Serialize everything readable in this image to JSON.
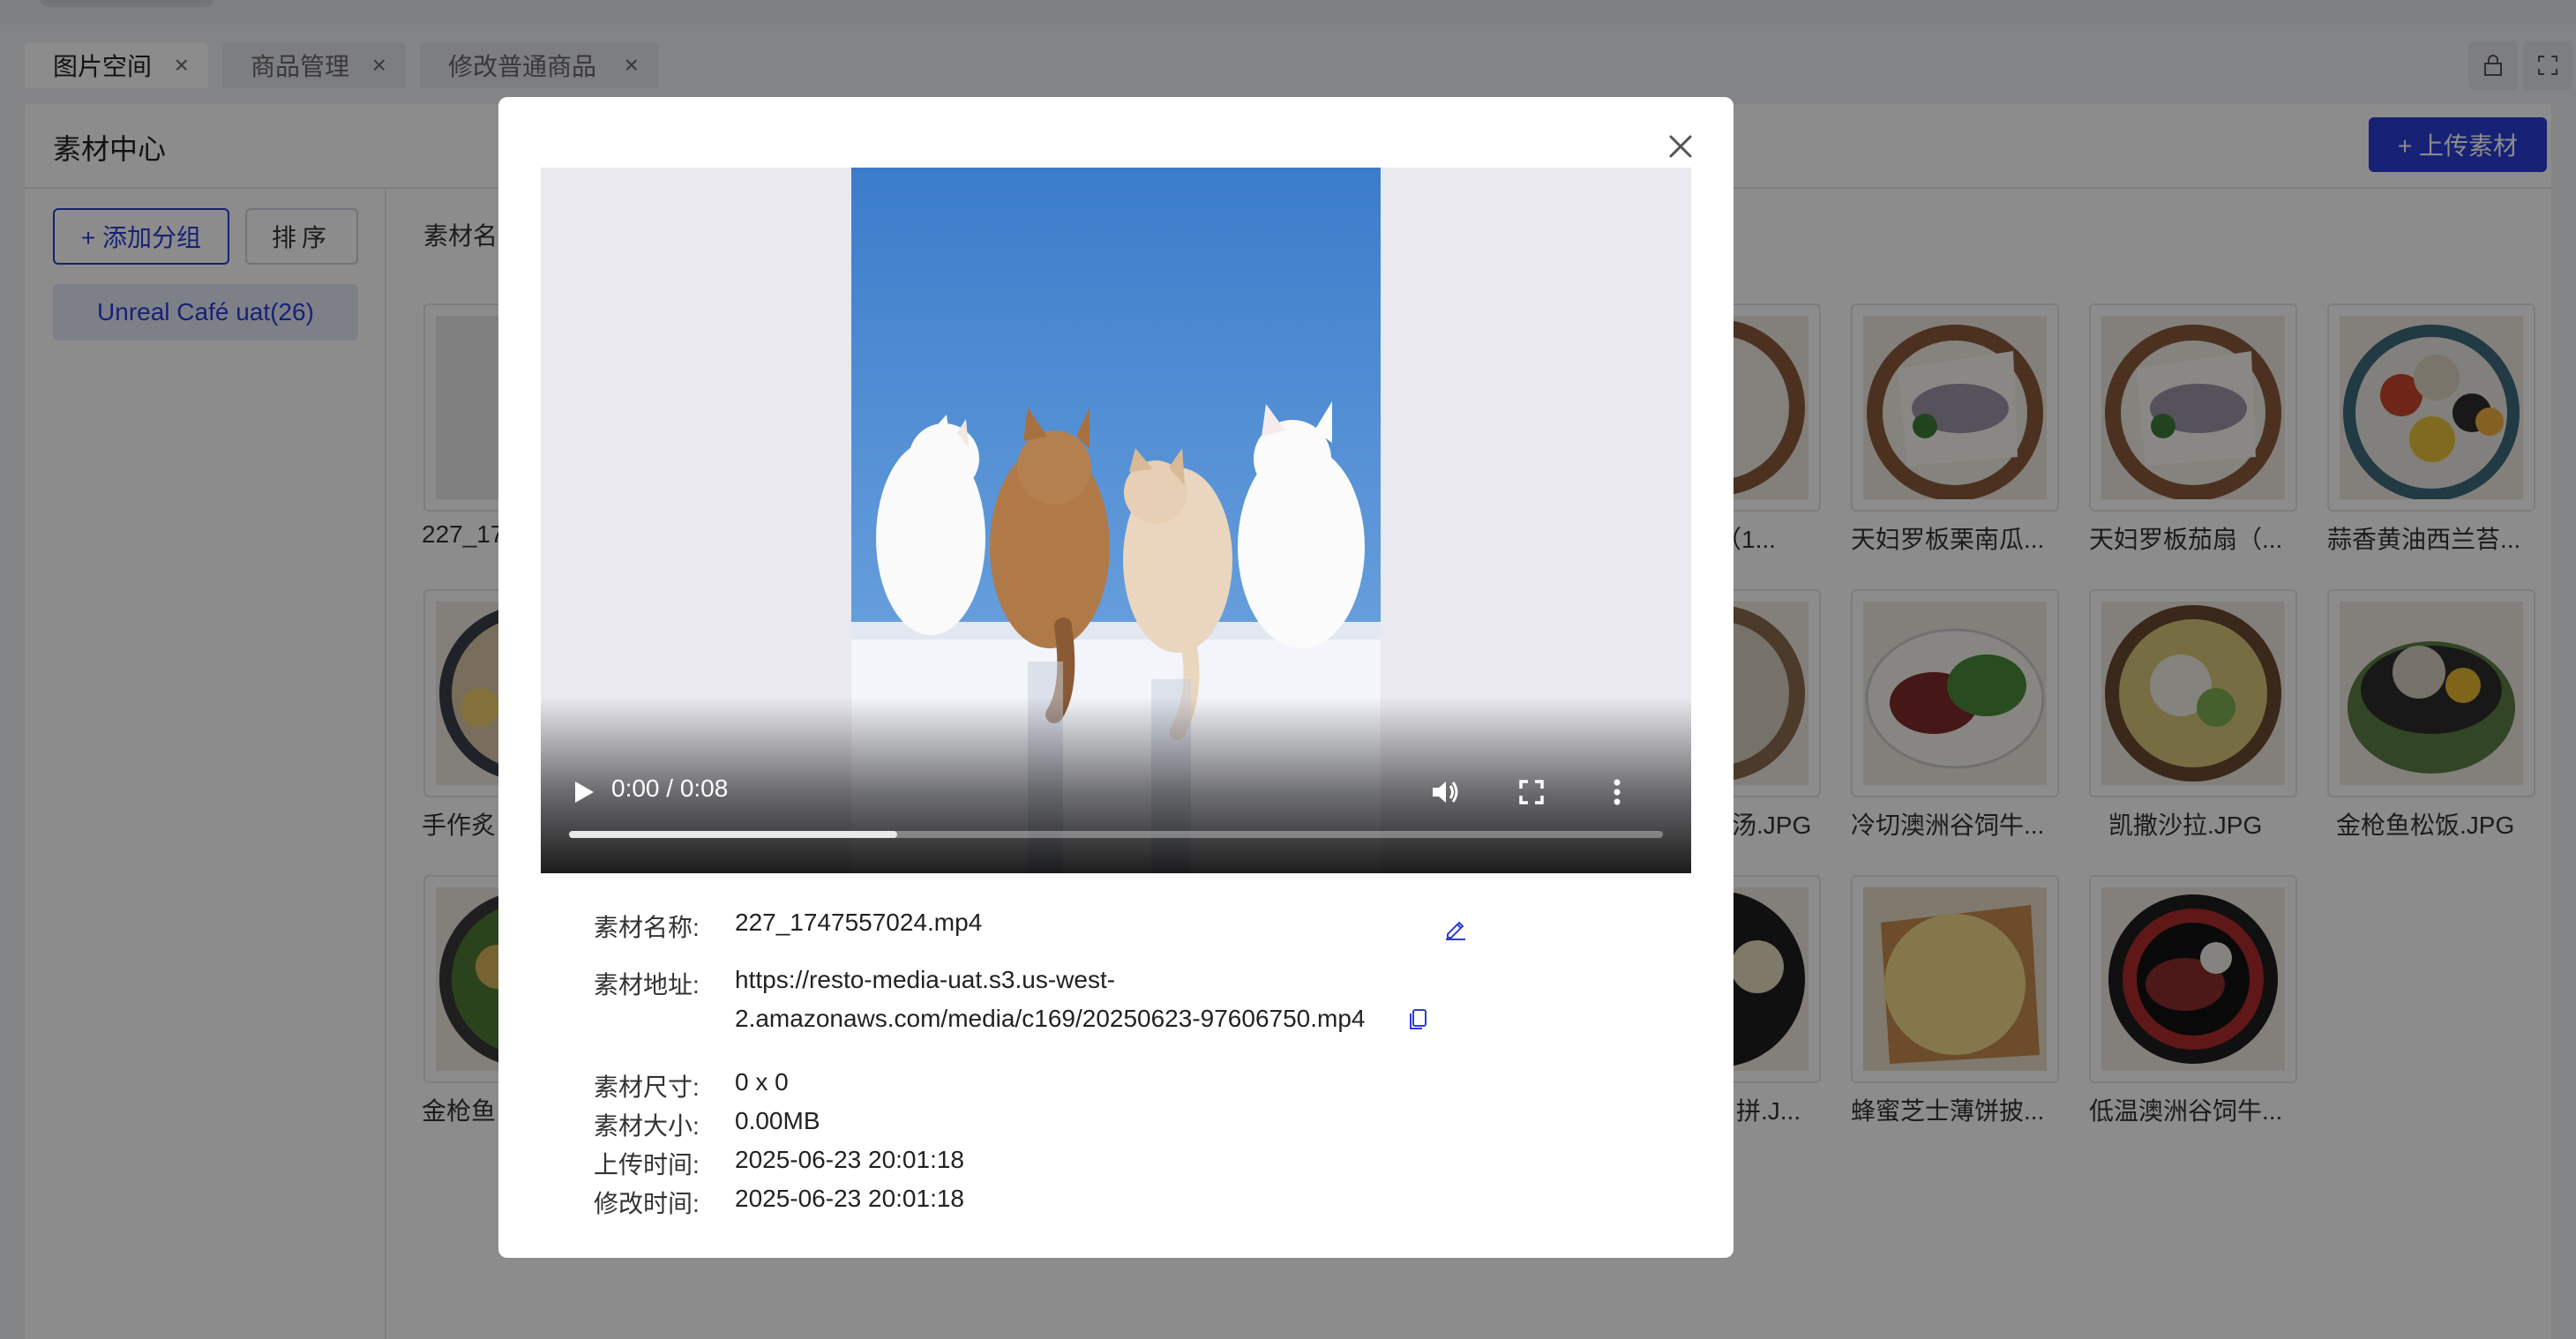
{
  "tabs": [
    {
      "label": "图片空间",
      "close": "×"
    },
    {
      "label": "商品管理",
      "close": "×"
    },
    {
      "label": "修改普通商品",
      "close": "×"
    }
  ],
  "panel": {
    "title": "素材中心",
    "upload_button": "+ 上传素材",
    "add_group_button": "+ 添加分组",
    "sort_button": "排序",
    "group_item": "Unreal Café uat(26)",
    "search_label": "素材名"
  },
  "thumbnails": [
    {
      "label": "227_17"
    },
    {
      "label": "（1..."
    },
    {
      "label": "天妇罗板栗南瓜..."
    },
    {
      "label": "天妇罗板茄扇（..."
    },
    {
      "label": "蒜香黄油西兰苔..."
    },
    {
      "label": "手作炙"
    },
    {
      "label": "汤.JPG"
    },
    {
      "label": "冷切澳洲谷饲牛..."
    },
    {
      "label": "凯撒沙拉.JPG"
    },
    {
      "label": "金枪鱼松饭.JPG"
    },
    {
      "label": "金枪鱼"
    },
    {
      "label": "拼.J..."
    },
    {
      "label": "蜂蜜芝士薄饼披..."
    },
    {
      "label": "低温澳洲谷饲牛..."
    }
  ],
  "modal": {
    "video": {
      "time": "0:00 / 0:08",
      "progress": 0.3
    },
    "info": {
      "name_label": "素材名称:",
      "name_value": "227_1747557024.mp4",
      "url_label": "素材地址:",
      "url_line1": "https://resto-media-uat.s3.us-west-",
      "url_line2": "2.amazonaws.com/media/c169/20250623-97606750.mp4",
      "size_label": "素材尺寸:",
      "size_value": "0 x 0",
      "filesize_label": "素材大小:",
      "filesize_value": "0.00MB",
      "upload_label": "上传时间:",
      "upload_value": "2025-06-23 20:01:18",
      "modified_label": "修改时间:",
      "modified_value": "2025-06-23 20:01:18"
    }
  },
  "colors": {
    "primary": "#2b3cd6",
    "overlay": "rgba(0,0,0,0.45)",
    "sky": "#3f7fce"
  },
  "icons": [
    "close-icon",
    "play-icon",
    "volume-icon",
    "fullscreen-icon",
    "more-vert-icon",
    "edit-icon",
    "copy-icon",
    "lock-icon",
    "expand-icon"
  ]
}
